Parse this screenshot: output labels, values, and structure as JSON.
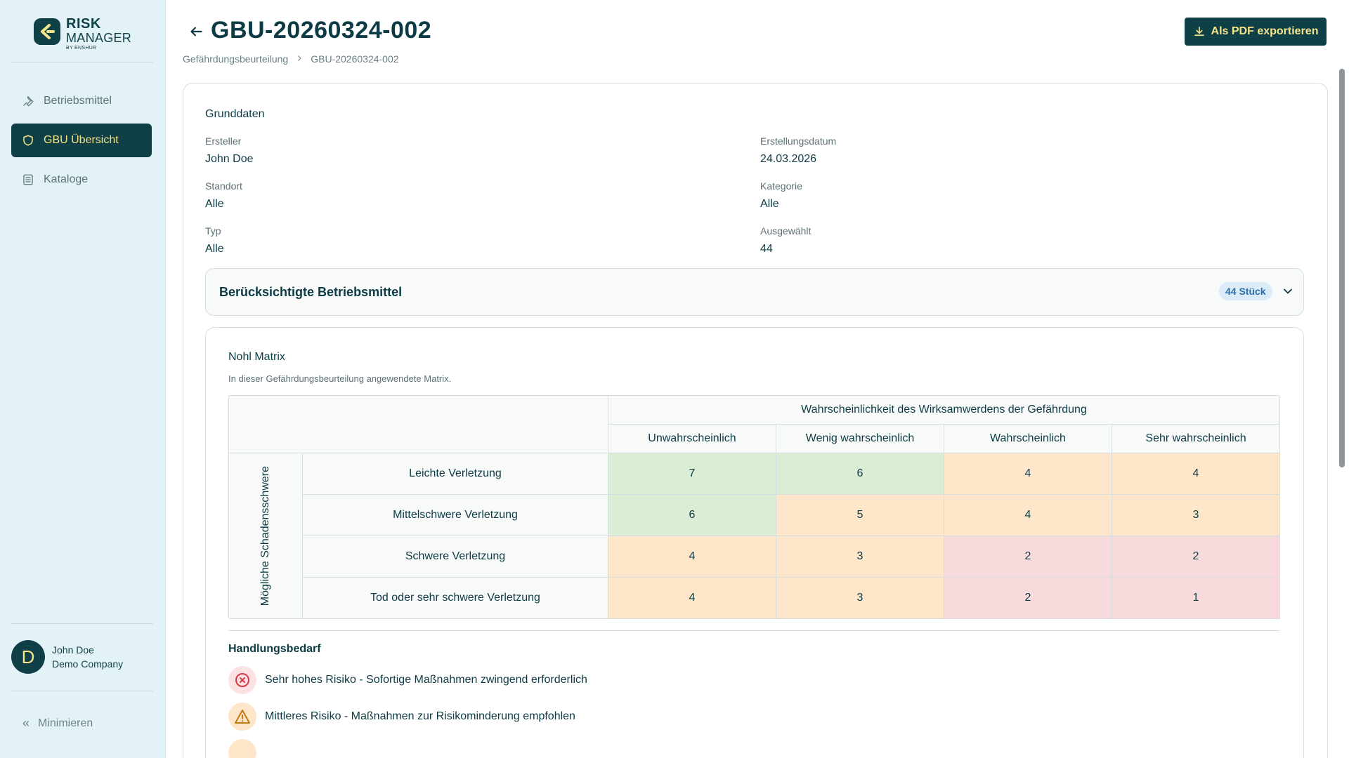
{
  "brand": {
    "line1": "RISK",
    "line2": "MANAGER",
    "line3": "BY ENSHUR"
  },
  "sidebar": {
    "items": [
      {
        "label": "Betriebsmittel",
        "icon": "wrench-icon"
      },
      {
        "label": "GBU Übersicht",
        "icon": "shield-icon",
        "active": true
      },
      {
        "label": "Kataloge",
        "icon": "list-icon"
      }
    ],
    "user": {
      "initial": "D",
      "name": "John Doe",
      "company": "Demo Company"
    },
    "minimize": "Minimieren"
  },
  "header": {
    "title": "GBU-20260324-002",
    "breadcrumb": [
      "Gefährdungsbeurteilung",
      "GBU-20260324-002"
    ],
    "export_label": "Als PDF exportieren"
  },
  "grunddaten": {
    "title": "Grunddaten",
    "fields": {
      "ersteller": {
        "label": "Ersteller",
        "value": "John Doe"
      },
      "erstellungsdatum": {
        "label": "Erstellungsdatum",
        "value": "24.03.2026"
      },
      "standort": {
        "label": "Standort",
        "value": "Alle"
      },
      "kategorie": {
        "label": "Kategorie",
        "value": "Alle"
      },
      "typ": {
        "label": "Typ",
        "value": "Alle"
      },
      "ausgewaehlt": {
        "label": "Ausgewählt",
        "value": "44"
      }
    }
  },
  "betriebsmittel": {
    "title": "Berücksichtigte Betriebsmittel",
    "count": "44 Stück"
  },
  "matrix": {
    "title": "Nohl Matrix",
    "subtitle": "In dieser Gefährdungsbeurteilung angewendete Matrix.",
    "col_group": "Wahrscheinlichkeit des Wirksamwerdens der Gefährdung",
    "row_group": "Mögliche Schadensschwere",
    "columns": [
      "Unwahrscheinlich",
      "Wenig wahrscheinlich",
      "Wahrscheinlich",
      "Sehr wahrscheinlich"
    ],
    "rows": [
      {
        "label": "Leichte Verletzung",
        "values": [
          "7",
          "6",
          "4",
          "4"
        ],
        "colors": [
          "green",
          "green",
          "orange",
          "orange"
        ]
      },
      {
        "label": "Mittelschwere Verletzung",
        "values": [
          "6",
          "5",
          "4",
          "3"
        ],
        "colors": [
          "green",
          "orange",
          "orange",
          "orange"
        ]
      },
      {
        "label": "Schwere Verletzung",
        "values": [
          "4",
          "3",
          "2",
          "2"
        ],
        "colors": [
          "orange",
          "orange",
          "red",
          "red"
        ]
      },
      {
        "label": "Tod oder sehr schwere Verletzung",
        "values": [
          "4",
          "3",
          "2",
          "1"
        ],
        "colors": [
          "orange",
          "orange",
          "red",
          "red"
        ]
      }
    ],
    "cell_colors": {
      "green": "#dcedd6",
      "orange": "#fde6c9",
      "red": "#f9dadc"
    }
  },
  "handlungsbedarf": {
    "title": "Handlungsbedarf",
    "items": [
      {
        "icon": "x-circle-icon",
        "text": "Sehr hohes Risiko - Sofortige Maßnahmen zwingend erforderlich"
      },
      {
        "icon": "warning-icon",
        "text": "Mittleres Risiko - Maßnahmen zur Risikominderung empfohlen"
      }
    ]
  },
  "colors": {
    "primary": "#0f3f47",
    "accent": "#f5e58a",
    "sidebar_bg": "#e3f2f6"
  }
}
